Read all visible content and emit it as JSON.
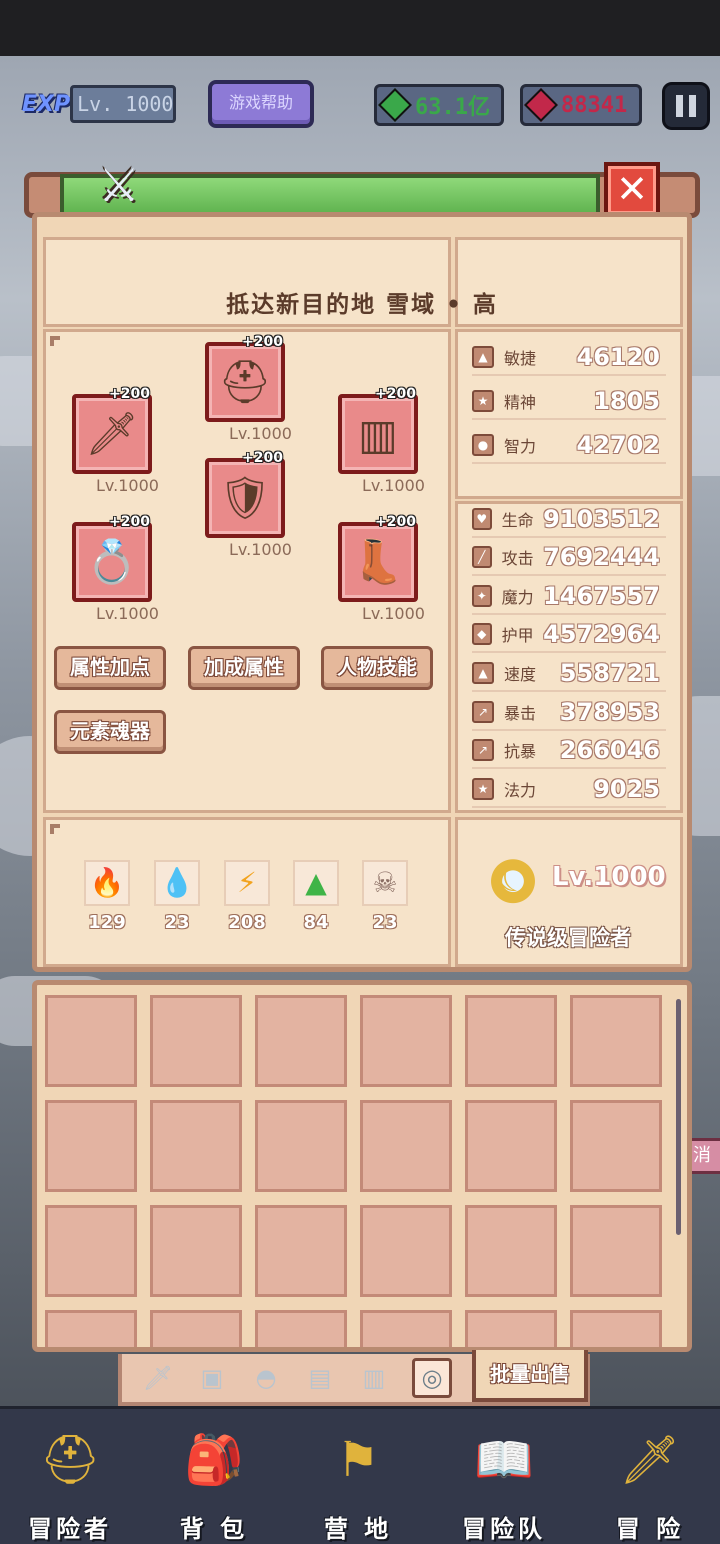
{
  "hud": {
    "exp_badge": "EXP",
    "level": "Lv. 1000",
    "help_label": "游戏帮助",
    "currency_green": "63.1亿",
    "currency_red": "88341",
    "currency_green_color": "#3aa84a",
    "currency_red_color": "#c2284a"
  },
  "panel": {
    "destination": "抵达新目的地 雪域 • 高",
    "close_icon": "✕",
    "header_icon": "crossed-swords-icon",
    "equipment": [
      {
        "slot": "weapon",
        "icon": "sword-icon",
        "glyph": "🗡",
        "plus": "+200",
        "level": "Lv.1000"
      },
      {
        "slot": "helmet",
        "icon": "helmet-icon",
        "glyph": "⛑",
        "plus": "+200",
        "level": "Lv.1000"
      },
      {
        "slot": "armor",
        "icon": "armor-icon",
        "glyph": "🛡",
        "plus": "+200",
        "level": "Lv.1000"
      },
      {
        "slot": "bracer",
        "icon": "bracer-icon",
        "glyph": "▥",
        "plus": "+200",
        "level": "Lv.1000"
      },
      {
        "slot": "ring",
        "icon": "ring-icon",
        "glyph": "💍",
        "plus": "+200",
        "level": "Lv.1000"
      },
      {
        "slot": "boots",
        "icon": "boots-icon",
        "glyph": "👢",
        "plus": "+200",
        "level": "Lv.1000"
      }
    ],
    "buttons": {
      "attr_points": "属性加点",
      "bonus_attr": "加成属性",
      "skills": "人物技能",
      "soul_gear": "元素魂器"
    },
    "elements": [
      {
        "name": "fire-element-icon",
        "glyph": "🔥",
        "value": "129",
        "color": "#e5462e"
      },
      {
        "name": "water-element-icon",
        "glyph": "💧",
        "value": "23",
        "color": "#4aa3e8"
      },
      {
        "name": "lightning-element-icon",
        "glyph": "⚡",
        "value": "208",
        "color": "#f2a31e"
      },
      {
        "name": "earth-element-icon",
        "glyph": "▲",
        "value": "84",
        "color": "#3fb447"
      },
      {
        "name": "dark-element-icon",
        "glyph": "☠",
        "value": "23",
        "color": "#8a6d63"
      }
    ],
    "base_stats": [
      {
        "name": "敏捷",
        "value": "46120",
        "icon": "agility-icon"
      },
      {
        "name": "精神",
        "value": "1805",
        "icon": "spirit-icon"
      },
      {
        "name": "智力",
        "value": "42702",
        "icon": "intellect-icon"
      }
    ],
    "combat_stats": [
      {
        "name": "生命",
        "value": "9103512",
        "icon": "heart-icon"
      },
      {
        "name": "攻击",
        "value": "7692444",
        "icon": "attack-icon"
      },
      {
        "name": "魔力",
        "value": "1467557",
        "icon": "magic-icon"
      },
      {
        "name": "护甲",
        "value": "4572964",
        "icon": "armor-stat-icon"
      },
      {
        "name": "速度",
        "value": "558721",
        "icon": "speed-icon"
      },
      {
        "name": "暴击",
        "value": "378953",
        "icon": "crit-icon"
      },
      {
        "name": "抗暴",
        "value": "266046",
        "icon": "crit-resist-icon"
      },
      {
        "name": "法力",
        "value": "9025",
        "icon": "mana-icon"
      }
    ],
    "rank": {
      "level": "Lv.1000",
      "title": "传说级冒险者"
    }
  },
  "inventory": {
    "bulk_sell": "批量出售",
    "filters": [
      {
        "name": "filter-weapon-icon",
        "glyph": "🗡"
      },
      {
        "name": "filter-shield-icon",
        "glyph": "▣"
      },
      {
        "name": "filter-helmet-icon",
        "glyph": "◓"
      },
      {
        "name": "filter-armor-icon",
        "glyph": "▤"
      },
      {
        "name": "filter-bracer-icon",
        "glyph": "▥"
      },
      {
        "name": "filter-ring-icon",
        "glyph": "◎"
      }
    ]
  },
  "side_tag": "消",
  "nav": [
    {
      "label": "冒险者",
      "icon": "adventurer-helmet-icon",
      "glyph": "⛑"
    },
    {
      "label": "背 包",
      "icon": "backpack-icon",
      "glyph": "🎒"
    },
    {
      "label": "营 地",
      "icon": "camp-banner-icon",
      "glyph": "⚑"
    },
    {
      "label": "冒险队",
      "icon": "team-book-icon",
      "glyph": "📖"
    },
    {
      "label": "冒 险",
      "icon": "sword-adventure-icon",
      "glyph": "🗡"
    }
  ]
}
